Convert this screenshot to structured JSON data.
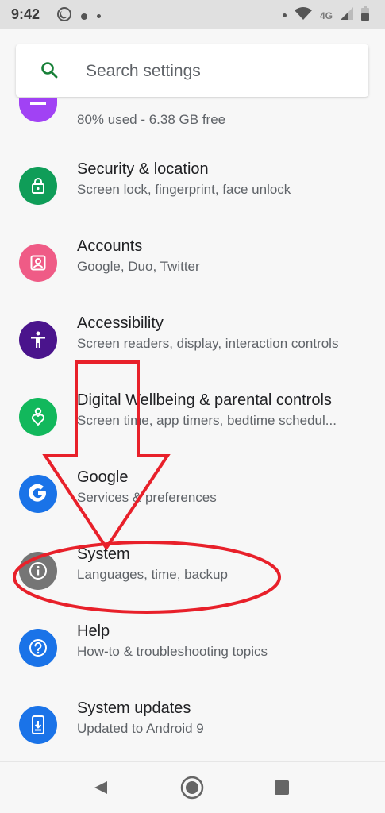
{
  "status_bar": {
    "time": "9:42",
    "network": "4G"
  },
  "search": {
    "placeholder": "Search settings"
  },
  "partial_item": {
    "subtitle": "80% used - 6.38 GB free"
  },
  "items": [
    {
      "title": "Security & location",
      "subtitle": "Screen lock, fingerprint, face unlock",
      "icon": "lock-icon",
      "color": "#0f9d58"
    },
    {
      "title": "Accounts",
      "subtitle": "Google, Duo, Twitter",
      "icon": "account-box-icon",
      "color": "#ef5b86"
    },
    {
      "title": "Accessibility",
      "subtitle": "Screen readers, display, interaction controls",
      "icon": "accessibility-icon",
      "color": "#4a148c"
    },
    {
      "title": "Digital Wellbeing & parental controls",
      "subtitle": "Screen time, app timers, bedtime schedul...",
      "icon": "wellbeing-icon",
      "color": "#12b85c"
    },
    {
      "title": "Google",
      "subtitle": "Services & preferences",
      "icon": "google-icon",
      "color": "#1a73e8"
    },
    {
      "title": "System",
      "subtitle": "Languages, time, backup",
      "icon": "info-icon",
      "color": "#757575"
    },
    {
      "title": "Help",
      "subtitle": "How-to & troubleshooting topics",
      "icon": "help-icon",
      "color": "#1a73e8"
    },
    {
      "title": "System updates",
      "subtitle": "Updated to Android 9",
      "icon": "system-update-icon",
      "color": "#1a73e8"
    }
  ],
  "annotation": {
    "color": "#e8202a",
    "arrow_points_to": "System",
    "circled_item": "System"
  }
}
